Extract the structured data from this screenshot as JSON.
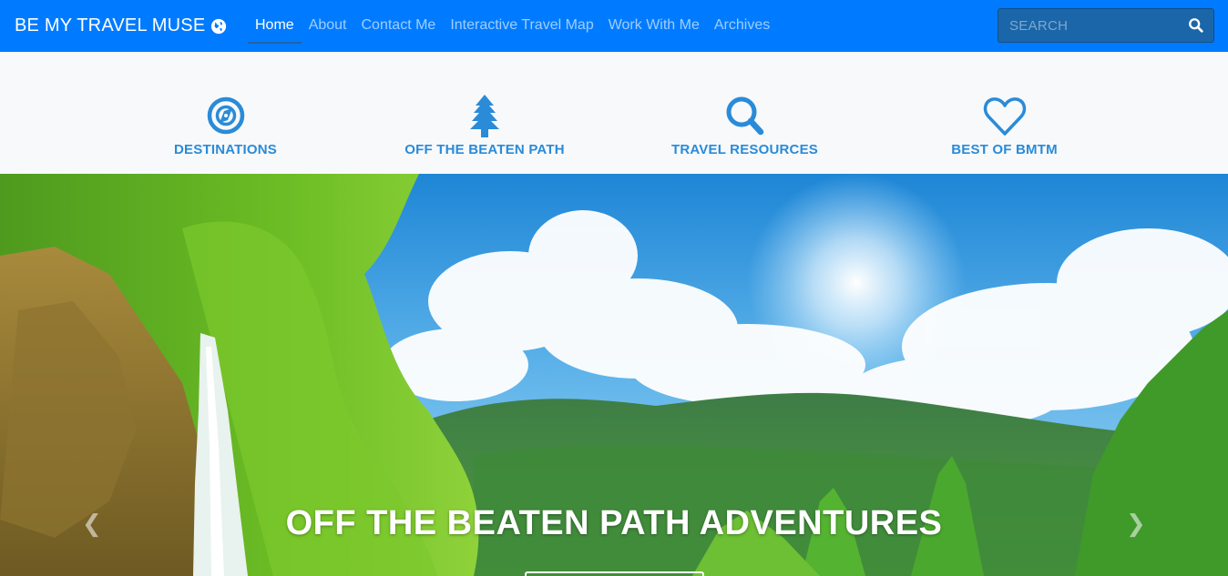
{
  "brand": {
    "title": "BE MY TRAVEL MUSE",
    "icon": "globe-icon"
  },
  "nav": {
    "items": [
      {
        "label": "Home",
        "active": true
      },
      {
        "label": "About"
      },
      {
        "label": "Contact Me"
      },
      {
        "label": "Interactive Travel Map"
      },
      {
        "label": "Work With Me"
      },
      {
        "label": "Archives"
      }
    ]
  },
  "search": {
    "placeholder": "SEARCH",
    "icon": "search-icon"
  },
  "categories": [
    {
      "label": "DESTINATIONS",
      "icon": "compass-icon"
    },
    {
      "label": "OFF THE BEATEN PATH",
      "icon": "tree-icon"
    },
    {
      "label": "TRAVEL RESOURCES",
      "icon": "magnifier-icon"
    },
    {
      "label": "BEST OF BMTM",
      "icon": "heart-icon"
    }
  ],
  "hero": {
    "title": "OFF THE BEATEN PATH ADVENTURES",
    "prev_icon": "chevron-left-icon",
    "next_icon": "chevron-right-icon"
  },
  "colors": {
    "navbar": "#007bff",
    "category_text": "#2a8bd8",
    "category_bg": "#f7f9fb"
  }
}
